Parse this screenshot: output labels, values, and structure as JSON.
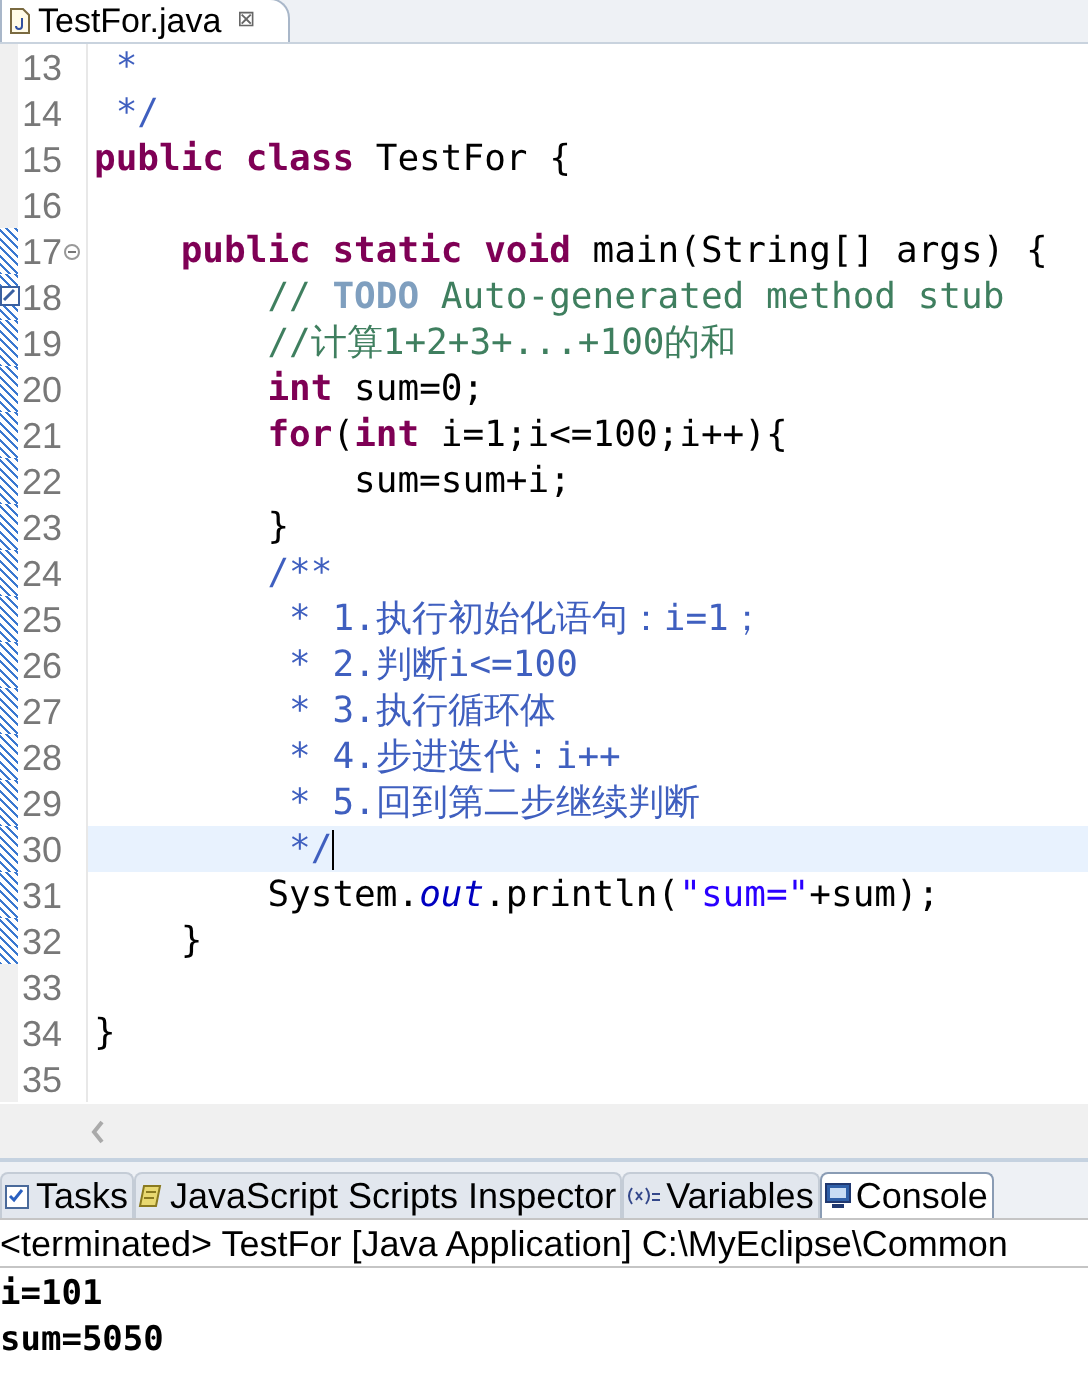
{
  "editor_tab": {
    "title": "TestFor.java",
    "close": "⊠"
  },
  "lines": [
    {
      "number": "13",
      "changed": false,
      "foldable": false,
      "task": false,
      "selected": false,
      "segments": [
        {
          "text": " *",
          "kind": "doc"
        }
      ]
    },
    {
      "number": "14",
      "changed": false,
      "foldable": false,
      "task": false,
      "selected": false,
      "segments": [
        {
          "text": " */",
          "kind": "doc"
        }
      ]
    },
    {
      "number": "15",
      "changed": false,
      "foldable": false,
      "task": false,
      "selected": false,
      "segments": [
        {
          "text": "public class",
          "kind": "keyword"
        },
        {
          "text": " TestFor {",
          "kind": "plain"
        }
      ]
    },
    {
      "number": "16",
      "changed": false,
      "foldable": false,
      "task": false,
      "selected": false
    },
    {
      "number": "17",
      "changed": true,
      "foldable": true,
      "task": false,
      "selected": false,
      "segments": [
        {
          "text": "    public static void",
          "kind": "keyword"
        },
        {
          "text": " main(String[] args) {",
          "kind": "plain"
        }
      ]
    },
    {
      "number": "18",
      "changed": true,
      "foldable": false,
      "task": true,
      "selected": false,
      "segments": [
        {
          "text": "        // ",
          "kind": "comment"
        },
        {
          "text": "TODO",
          "kind": "todo"
        },
        {
          "text": " Auto-generated method stub",
          "kind": "comment"
        }
      ]
    },
    {
      "number": "19",
      "changed": true,
      "foldable": false,
      "task": false,
      "selected": false,
      "segments": [
        {
          "text": "        //计算1+2+3+...+100的和",
          "kind": "comment"
        }
      ]
    },
    {
      "number": "20",
      "changed": true,
      "foldable": false,
      "task": false,
      "selected": false,
      "segments": [
        {
          "text": "        int",
          "kind": "keyword"
        },
        {
          "text": " sum=0;",
          "kind": "plain"
        }
      ]
    },
    {
      "number": "21",
      "changed": true,
      "foldable": false,
      "task": false,
      "selected": false,
      "segments": [
        {
          "text": "        for",
          "kind": "keyword"
        },
        {
          "text": "(",
          "kind": "plain"
        },
        {
          "text": "int",
          "kind": "keyword"
        },
        {
          "text": " i=1;i<=100;i++){",
          "kind": "plain"
        }
      ]
    },
    {
      "number": "22",
      "changed": true,
      "foldable": false,
      "task": false,
      "selected": false,
      "segments": [
        {
          "text": "            sum=sum+i;",
          "kind": "plain"
        }
      ]
    },
    {
      "number": "23",
      "changed": true,
      "foldable": false,
      "task": false,
      "selected": false,
      "segments": [
        {
          "text": "        }",
          "kind": "plain"
        }
      ]
    },
    {
      "number": "24",
      "changed": true,
      "foldable": false,
      "task": false,
      "selected": false,
      "segments": [
        {
          "text": "        /**",
          "kind": "doc"
        }
      ]
    },
    {
      "number": "25",
      "changed": true,
      "foldable": false,
      "task": false,
      "selected": false,
      "segments": [
        {
          "text": "         * 1.执行初始化语句：i=1；",
          "kind": "doc"
        }
      ]
    },
    {
      "number": "26",
      "changed": true,
      "foldable": false,
      "task": false,
      "selected": false,
      "segments": [
        {
          "text": "         * 2.判断i<=100",
          "kind": "doc"
        }
      ]
    },
    {
      "number": "27",
      "changed": true,
      "foldable": false,
      "task": false,
      "selected": false,
      "segments": [
        {
          "text": "         * 3.执行循环体",
          "kind": "doc"
        }
      ]
    },
    {
      "number": "28",
      "changed": true,
      "foldable": false,
      "task": false,
      "selected": false,
      "segments": [
        {
          "text": "         * 4.步进迭代：i++",
          "kind": "doc"
        }
      ]
    },
    {
      "number": "29",
      "changed": true,
      "foldable": false,
      "task": false,
      "selected": false,
      "segments": [
        {
          "text": "         * 5.回到第二步继续判断",
          "kind": "doc"
        }
      ]
    },
    {
      "number": "30",
      "changed": true,
      "foldable": false,
      "task": false,
      "selected": true,
      "segments": [
        {
          "text": "         */",
          "kind": "doc"
        }
      ]
    },
    {
      "number": "31",
      "changed": true,
      "foldable": false,
      "task": false,
      "selected": false,
      "segments": [
        {
          "text": "        System.",
          "kind": "plain"
        },
        {
          "text": "out",
          "kind": "field"
        },
        {
          "text": ".println(",
          "kind": "plain"
        },
        {
          "text": "\"sum=\"",
          "kind": "string"
        },
        {
          "text": "+sum);",
          "kind": "plain"
        }
      ]
    },
    {
      "number": "32",
      "changed": true,
      "foldable": false,
      "task": false,
      "selected": false,
      "segments": [
        {
          "text": "    }",
          "kind": "plain"
        }
      ]
    },
    {
      "number": "33",
      "changed": false,
      "foldable": false,
      "task": false,
      "selected": false
    },
    {
      "number": "34",
      "changed": false,
      "foldable": false,
      "task": false,
      "selected": false,
      "segments": [
        {
          "text": "}",
          "kind": "plain"
        }
      ]
    },
    {
      "number": "35",
      "changed": false,
      "foldable": false,
      "task": false,
      "selected": false
    }
  ],
  "views": [
    {
      "label": "Tasks",
      "selected": false
    },
    {
      "label": "JavaScript Scripts Inspector",
      "selected": false
    },
    {
      "label": "Variables",
      "selected": false
    },
    {
      "label": "Console",
      "selected": true
    }
  ],
  "console": {
    "header": "<terminated> TestFor [Java Application] C:\\MyEclipse\\Common",
    "output": [
      "i=101",
      "sum=5050"
    ]
  }
}
